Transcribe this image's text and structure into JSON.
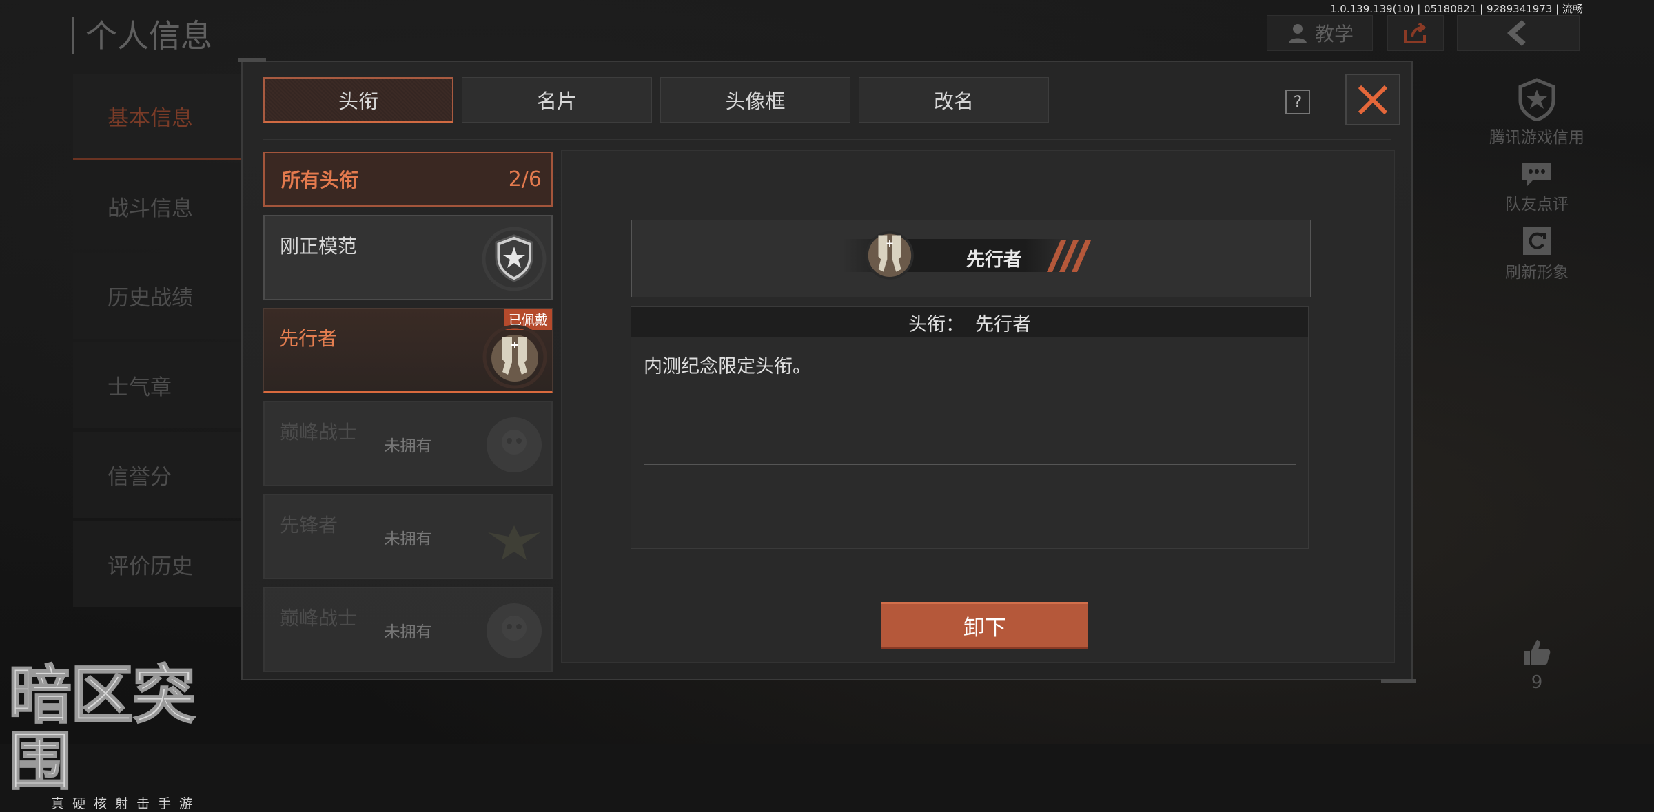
{
  "version_info": "1.0.139.139(10) | 05180821 | 9289341973 | 流畅",
  "page_title": "个人信息",
  "top_buttons": {
    "tutorial": "教学"
  },
  "left_nav": [
    "基本信息",
    "战斗信息",
    "历史战绩",
    "士气章",
    "信誉分",
    "评价历史"
  ],
  "side_buttons": {
    "credit": "腾讯游戏信用",
    "teammate_review": "队友点评",
    "refresh": "刷新形象"
  },
  "likes": "9",
  "logo": {
    "title": "暗区突围",
    "subtitle": "真硬核射击手游"
  },
  "dialog": {
    "tabs": [
      "头衔",
      "名片",
      "头像框",
      "改名"
    ],
    "help": "?",
    "list_header": {
      "label": "所有头衔",
      "count": "2/6"
    },
    "titles": [
      {
        "name": "刚正模范",
        "status": "owned",
        "icon": "shield-star-badge-icon"
      },
      {
        "name": "先行者",
        "status": "equipped",
        "tag": "已佩戴",
        "icon": "crossed-pistols-badge-icon"
      },
      {
        "name": "巅峰战士",
        "status": "locked",
        "lock_text": "未拥有",
        "icon": "skull-badge-icon"
      },
      {
        "name": "先锋者",
        "status": "locked",
        "lock_text": "未拥有",
        "icon": "winged-star-badge-icon"
      },
      {
        "name": "巅峰战士",
        "status": "locked",
        "lock_text": "未拥有",
        "icon": "skull-badge-icon"
      }
    ],
    "detail": {
      "preview_name": "先行者",
      "title_label": "头衔：",
      "title_value": "先行者",
      "description": "内测纪念限定头衔。",
      "action_button": "卸下"
    }
  },
  "colors": {
    "accent": "#d86a3e",
    "button": "#b5583a"
  }
}
